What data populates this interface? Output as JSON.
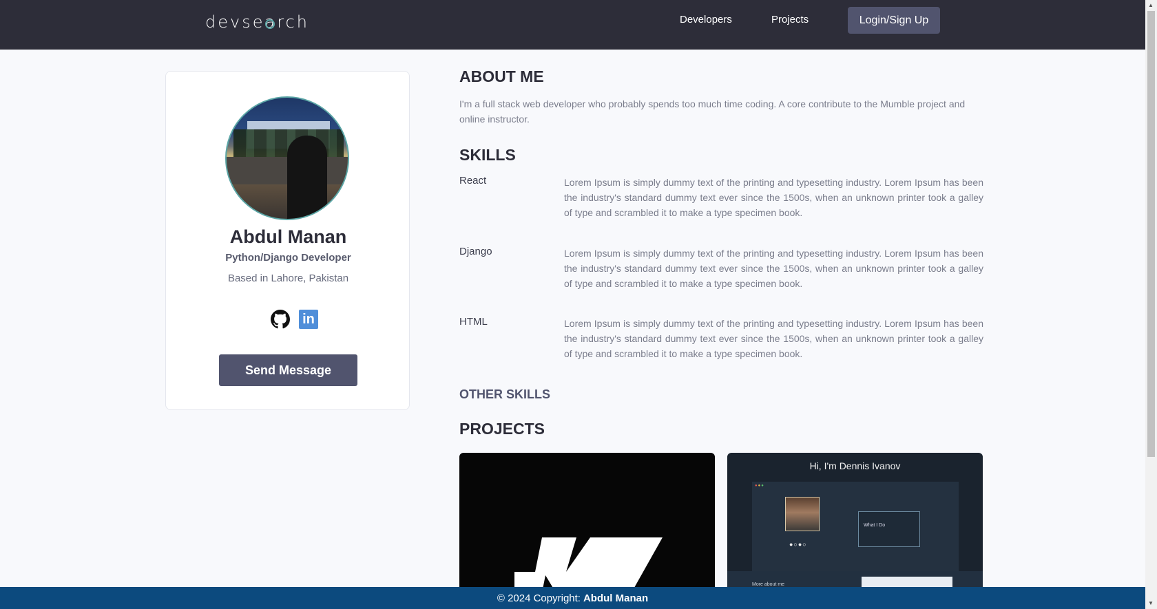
{
  "header": {
    "logo_prefix": "devse",
    "logo_mid": "a",
    "logo_suffix": "rch",
    "nav": {
      "developers": "Developers",
      "projects": "Projects",
      "login": "Login/Sign Up"
    }
  },
  "profile": {
    "name": "Abdul Manan",
    "role": "Python/Django Developer",
    "location": "Based in Lahore, Pakistan",
    "social_icons": [
      "github-icon",
      "linkedin-icon"
    ],
    "linkedin_text": "in",
    "send_message": "Send Message"
  },
  "about": {
    "heading": "ABOUT ME",
    "text": "I'm a full stack web developer who probably spends too much time coding. A core contribute to the Mumble project and online instructor."
  },
  "skills": {
    "heading": "SKILLS",
    "items": [
      {
        "name": "React",
        "description": "Lorem Ipsum is simply dummy text of the printing and typesetting industry. Lorem Ipsum has been the industry's standard dummy text ever since the 1500s, when an unknown printer took a galley of type and scrambled it to make a type specimen book."
      },
      {
        "name": "Django",
        "description": "Lorem Ipsum is simply dummy text of the printing and typesetting industry. Lorem Ipsum has been the industry's standard dummy text ever since the 1500s, when an unknown printer took a galley of type and scrambled it to make a type specimen book."
      },
      {
        "name": "HTML",
        "description": "Lorem Ipsum is simply dummy text of the printing and typesetting industry. Lorem Ipsum has been the industry's standard dummy text ever since the 1500s, when an unknown printer took a galley of type and scrambled it to make a type specimen book."
      }
    ],
    "other_heading": "OTHER SKILLS"
  },
  "projects": {
    "heading": "PROJECTS",
    "thumb2_title": "Hi, I'm Dennis Ivanov",
    "thumb2_small_heading": "What I Do",
    "thumb2_about": "More about me"
  },
  "footer": {
    "prefix": "© 2024 Copyright:",
    "author": "Abdul Manan"
  },
  "colors": {
    "header_bg": "#2d2d39",
    "accent_button": "#51546e",
    "footer_bg": "#0c4a7e",
    "avatar_border": "#5aa5a5",
    "linkedin": "#4f8ed9"
  }
}
